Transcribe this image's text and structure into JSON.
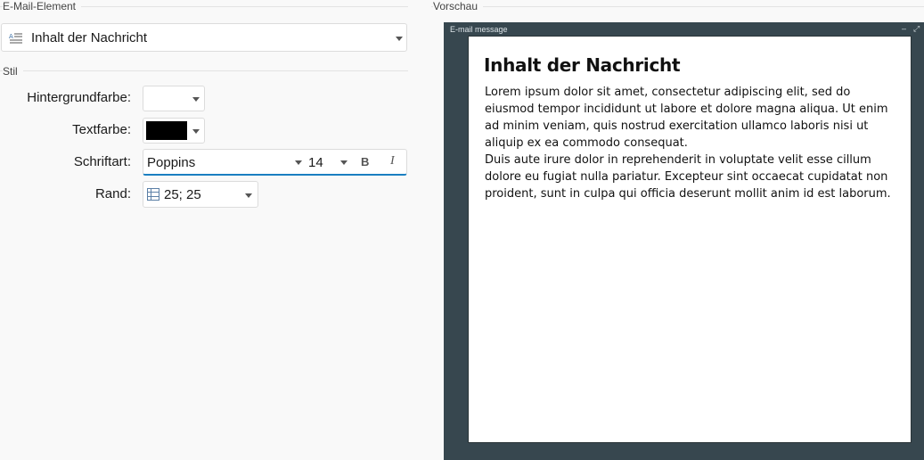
{
  "sections": {
    "email_element": "E-Mail-Element",
    "style": "Stil",
    "preview": "Vorschau"
  },
  "element_select": {
    "value": "Inhalt der Nachricht",
    "icon": "text-lines-icon"
  },
  "fields": {
    "background_label": "Hintergrundfarbe:",
    "background_color": "#ffffff",
    "text_color_label": "Textfarbe:",
    "text_color": "#000000",
    "font_label": "Schriftart:",
    "font_value": "Poppins",
    "font_size": "14",
    "bold_label": "B",
    "italic_label": "I",
    "border_label": "Rand:",
    "border_value": "25; 25",
    "border_icon": "border-grid-icon"
  },
  "preview": {
    "window_title": "E-mail message",
    "heading": "Inhalt der Nachricht",
    "paragraphs": [
      "Lorem ipsum dolor sit amet, consectetur adipiscing elit, sed do eiusmod tempor incididunt ut labore et dolore magna aliqua. Ut enim ad minim veniam, quis nostrud exercitation ullamco laboris nisi ut aliquip ex ea commodo consequat.",
      "Duis aute irure dolor in reprehenderit in voluptate velit esse cillum dolore eu fugiat nulla pariatur. Excepteur sint occaecat cupidatat non proident, sunt in culpa qui officia deserunt mollit anim id est laborum."
    ],
    "frame_color": "#37474f"
  }
}
